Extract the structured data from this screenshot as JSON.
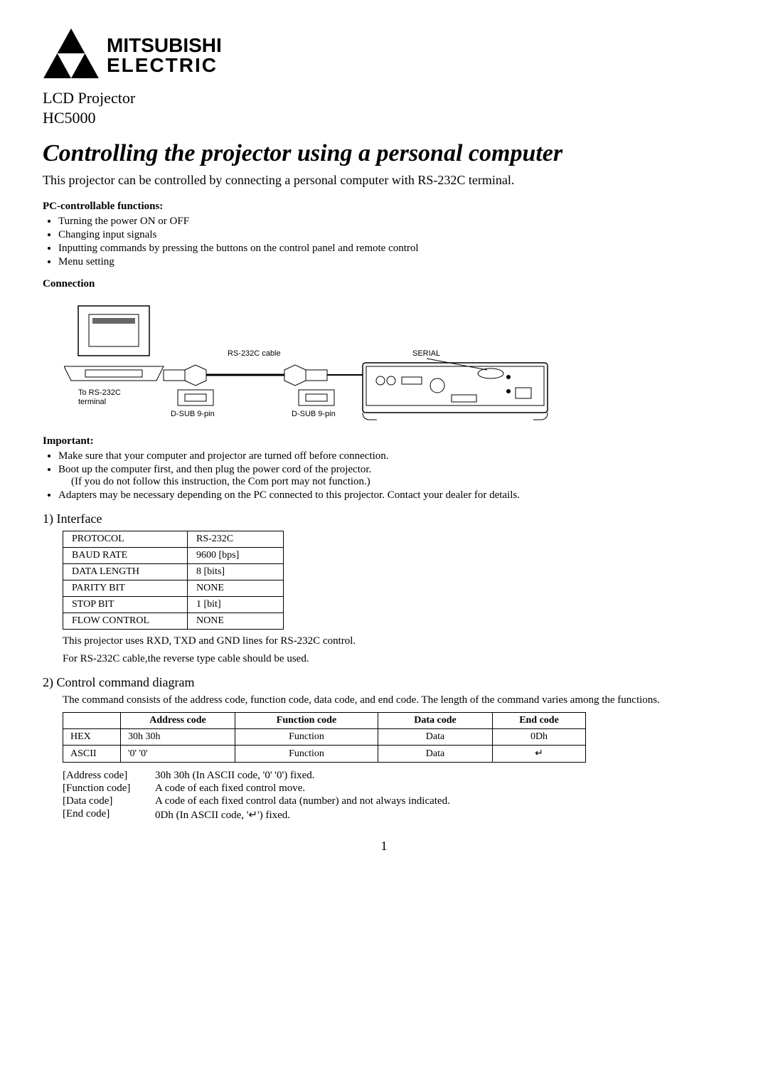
{
  "brand_top": "MITSUBISHI",
  "brand_bottom": "ELECTRIC",
  "product_line": "LCD Projector",
  "model": "HC5000",
  "title": "Controlling the projector using a personal computer",
  "lead": "This projector can be controlled by connecting a personal computer with RS-232C terminal.",
  "pc_head": "PC-controllable functions:",
  "pc_items": [
    "Turning the power ON or OFF",
    "Changing input signals",
    "Inputting commands by pressing the buttons on the control panel and remote control",
    "Menu setting"
  ],
  "conn_head": "Connection",
  "diagram_labels": {
    "to_terminal_1": "To RS-232C",
    "to_terminal_2": "terminal",
    "cable": "RS-232C cable",
    "dsub_left": "D-SUB 9-pin",
    "dsub_right": "D-SUB 9-pin",
    "serial": "SERIAL"
  },
  "important_head": "Important:",
  "important_items": [
    "Make sure that your computer and projector are turned off before connection.",
    "Boot up the computer first, and then plug the power cord of the projector.",
    "Adapters may be necessary depending on the PC connected to this projector. Contact your dealer for details."
  ],
  "important_sub": "(If you do not follow this instruction, the Com port may not function.)",
  "sec1": "1) Interface",
  "iface_rows": [
    [
      "PROTOCOL",
      "RS-232C"
    ],
    [
      "BAUD RATE",
      "9600 [bps]"
    ],
    [
      "DATA LENGTH",
      "8 [bits]"
    ],
    [
      "PARITY BIT",
      "NONE"
    ],
    [
      "STOP BIT",
      "1 [bit]"
    ],
    [
      "FLOW CONTROL",
      "NONE"
    ]
  ],
  "iface_note1": "This projector uses RXD, TXD and GND lines for RS-232C control.",
  "iface_note2": "For RS-232C cable,the reverse type cable should be used.",
  "sec2": "2) Control command diagram",
  "sec2_para": "The command consists of the address code, function code, data code, and end code. The length of the command varies among the functions.",
  "cmd_headers": [
    "",
    "Address code",
    "Function code",
    "Data code",
    "End code"
  ],
  "cmd_rows": [
    [
      "HEX",
      "30h 30h",
      "Function",
      "Data",
      "0Dh"
    ],
    [
      "ASCII",
      "'0' '0'",
      "Function",
      "Data",
      "↵"
    ]
  ],
  "defs": [
    [
      "[Address code]",
      "30h 30h (In ASCII code, '0' '0') fixed."
    ],
    [
      "[Function code]",
      "A code of each fixed control move."
    ],
    [
      "[Data code]",
      "A code of each fixed control data (number) and not always indicated."
    ],
    [
      "[End code]",
      "0Dh (In ASCII code, '↵') fixed."
    ]
  ],
  "page": "1"
}
